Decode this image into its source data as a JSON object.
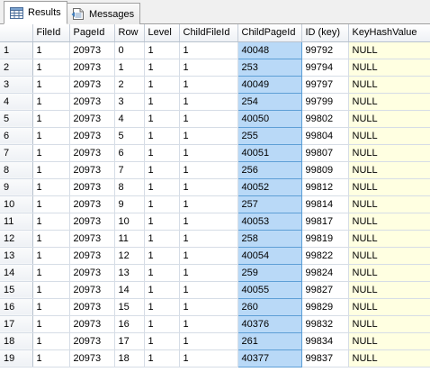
{
  "tabs": [
    {
      "label": "Results",
      "icon": "grid-results-icon",
      "active": true
    },
    {
      "label": "Messages",
      "icon": "messages-document-icon",
      "active": false
    }
  ],
  "columns": [
    "",
    "FileId",
    "PageId",
    "Row",
    "Level",
    "ChildFileId",
    "ChildPageId",
    "ID (key)",
    "KeyHashValue"
  ],
  "rows": [
    {
      "n": "1",
      "FileId": "1",
      "PageId": "20973",
      "Row": "0",
      "Level": "1",
      "ChildFileId": "1",
      "ChildPageId": "40048",
      "ID": "99792",
      "KeyHashValue": "NULL"
    },
    {
      "n": "2",
      "FileId": "1",
      "PageId": "20973",
      "Row": "1",
      "Level": "1",
      "ChildFileId": "1",
      "ChildPageId": "253",
      "ID": "99794",
      "KeyHashValue": "NULL"
    },
    {
      "n": "3",
      "FileId": "1",
      "PageId": "20973",
      "Row": "2",
      "Level": "1",
      "ChildFileId": "1",
      "ChildPageId": "40049",
      "ID": "99797",
      "KeyHashValue": "NULL"
    },
    {
      "n": "4",
      "FileId": "1",
      "PageId": "20973",
      "Row": "3",
      "Level": "1",
      "ChildFileId": "1",
      "ChildPageId": "254",
      "ID": "99799",
      "KeyHashValue": "NULL"
    },
    {
      "n": "5",
      "FileId": "1",
      "PageId": "20973",
      "Row": "4",
      "Level": "1",
      "ChildFileId": "1",
      "ChildPageId": "40050",
      "ID": "99802",
      "KeyHashValue": "NULL"
    },
    {
      "n": "6",
      "FileId": "1",
      "PageId": "20973",
      "Row": "5",
      "Level": "1",
      "ChildFileId": "1",
      "ChildPageId": "255",
      "ID": "99804",
      "KeyHashValue": "NULL"
    },
    {
      "n": "7",
      "FileId": "1",
      "PageId": "20973",
      "Row": "6",
      "Level": "1",
      "ChildFileId": "1",
      "ChildPageId": "40051",
      "ID": "99807",
      "KeyHashValue": "NULL"
    },
    {
      "n": "8",
      "FileId": "1",
      "PageId": "20973",
      "Row": "7",
      "Level": "1",
      "ChildFileId": "1",
      "ChildPageId": "256",
      "ID": "99809",
      "KeyHashValue": "NULL"
    },
    {
      "n": "9",
      "FileId": "1",
      "PageId": "20973",
      "Row": "8",
      "Level": "1",
      "ChildFileId": "1",
      "ChildPageId": "40052",
      "ID": "99812",
      "KeyHashValue": "NULL"
    },
    {
      "n": "10",
      "FileId": "1",
      "PageId": "20973",
      "Row": "9",
      "Level": "1",
      "ChildFileId": "1",
      "ChildPageId": "257",
      "ID": "99814",
      "KeyHashValue": "NULL"
    },
    {
      "n": "11",
      "FileId": "1",
      "PageId": "20973",
      "Row": "10",
      "Level": "1",
      "ChildFileId": "1",
      "ChildPageId": "40053",
      "ID": "99817",
      "KeyHashValue": "NULL"
    },
    {
      "n": "12",
      "FileId": "1",
      "PageId": "20973",
      "Row": "11",
      "Level": "1",
      "ChildFileId": "1",
      "ChildPageId": "258",
      "ID": "99819",
      "KeyHashValue": "NULL"
    },
    {
      "n": "13",
      "FileId": "1",
      "PageId": "20973",
      "Row": "12",
      "Level": "1",
      "ChildFileId": "1",
      "ChildPageId": "40054",
      "ID": "99822",
      "KeyHashValue": "NULL"
    },
    {
      "n": "14",
      "FileId": "1",
      "PageId": "20973",
      "Row": "13",
      "Level": "1",
      "ChildFileId": "1",
      "ChildPageId": "259",
      "ID": "99824",
      "KeyHashValue": "NULL"
    },
    {
      "n": "15",
      "FileId": "1",
      "PageId": "20973",
      "Row": "14",
      "Level": "1",
      "ChildFileId": "1",
      "ChildPageId": "40055",
      "ID": "99827",
      "KeyHashValue": "NULL"
    },
    {
      "n": "16",
      "FileId": "1",
      "PageId": "20973",
      "Row": "15",
      "Level": "1",
      "ChildFileId": "1",
      "ChildPageId": "260",
      "ID": "99829",
      "KeyHashValue": "NULL"
    },
    {
      "n": "17",
      "FileId": "1",
      "PageId": "20973",
      "Row": "16",
      "Level": "1",
      "ChildFileId": "1",
      "ChildPageId": "40376",
      "ID": "99832",
      "KeyHashValue": "NULL"
    },
    {
      "n": "18",
      "FileId": "1",
      "PageId": "20973",
      "Row": "17",
      "Level": "1",
      "ChildFileId": "1",
      "ChildPageId": "261",
      "ID": "99834",
      "KeyHashValue": "NULL"
    },
    {
      "n": "19",
      "FileId": "1",
      "PageId": "20973",
      "Row": "18",
      "Level": "1",
      "ChildFileId": "1",
      "ChildPageId": "40377",
      "ID": "99837",
      "KeyHashValue": "NULL"
    }
  ],
  "colors": {
    "selected_column": "#b9d9f7",
    "null_cell": "#ffffe1",
    "header": "#eef1f5"
  }
}
